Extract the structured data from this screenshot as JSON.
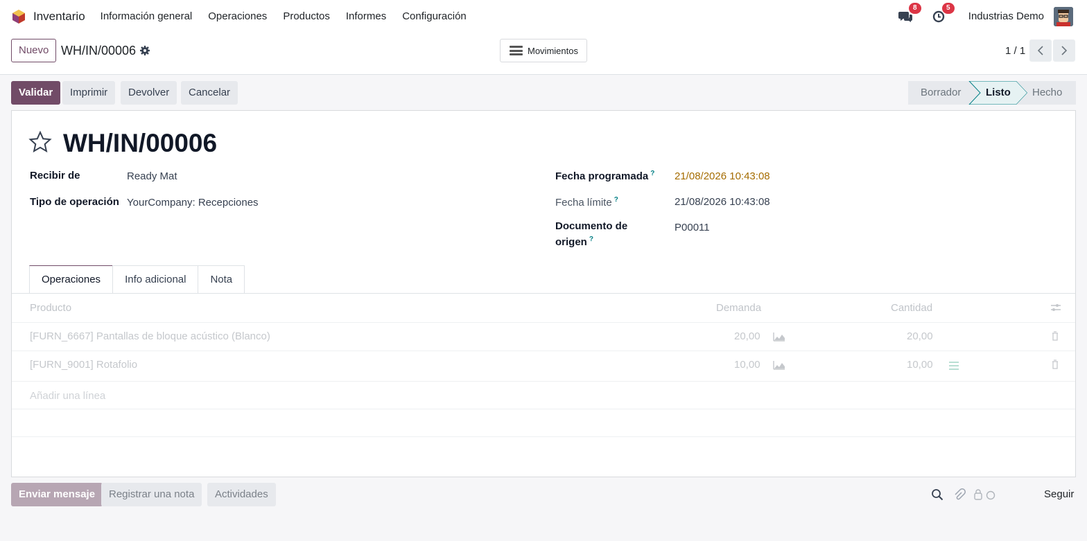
{
  "navbar": {
    "app_name": "Inventario",
    "menu": [
      "Información general",
      "Operaciones",
      "Productos",
      "Informes",
      "Configuración"
    ],
    "messages_count": "8",
    "activities_count": "5",
    "company": "Industrias Demo"
  },
  "control_panel": {
    "new_label": "Nuevo",
    "breadcrumb": "WH/IN/00006",
    "smart_button": "Movimientos",
    "pager": "1 / 1"
  },
  "actions": {
    "validate": "Validar",
    "print": "Imprimir",
    "return": "Devolver",
    "cancel": "Cancelar"
  },
  "statusbar": {
    "stages": [
      "Borrador",
      "Listo",
      "Hecho"
    ],
    "active": "Listo"
  },
  "form": {
    "title": "WH/IN/00006",
    "receive_from_label": "Recibir de",
    "receive_from": "Ready Mat",
    "operation_type_label": "Tipo de operación",
    "operation_type": "YourCompany: Recepciones",
    "scheduled_date_label": "Fecha programada",
    "scheduled_date": "21/08/2026 10:43:08",
    "deadline_label": "Fecha límite",
    "deadline": "21/08/2026 10:43:08",
    "source_doc_label_1": "Documento de",
    "source_doc_label_2": "origen",
    "source_doc": "P00011",
    "help_mark": "?"
  },
  "tabs": [
    "Operaciones",
    "Info adicional",
    "Nota"
  ],
  "table": {
    "headers": {
      "product": "Producto",
      "demand": "Demanda",
      "quantity": "Cantidad"
    },
    "rows": [
      {
        "product": "[FURN_6667] Pantallas de bloque acústico (Blanco)",
        "demand": "20,00",
        "quantity": "20,00"
      },
      {
        "product": "[FURN_9001] Rotafolio",
        "demand": "10,00",
        "quantity": "10,00"
      }
    ],
    "add_line": "Añadir una línea"
  },
  "chatter": {
    "send_message": "Enviar mensaje",
    "log_note": "Registrar una nota",
    "activities": "Actividades",
    "follow": "Seguir"
  },
  "colors": {
    "brand": "#714b67",
    "teal": "#017e84",
    "warning": "#a56c00"
  }
}
